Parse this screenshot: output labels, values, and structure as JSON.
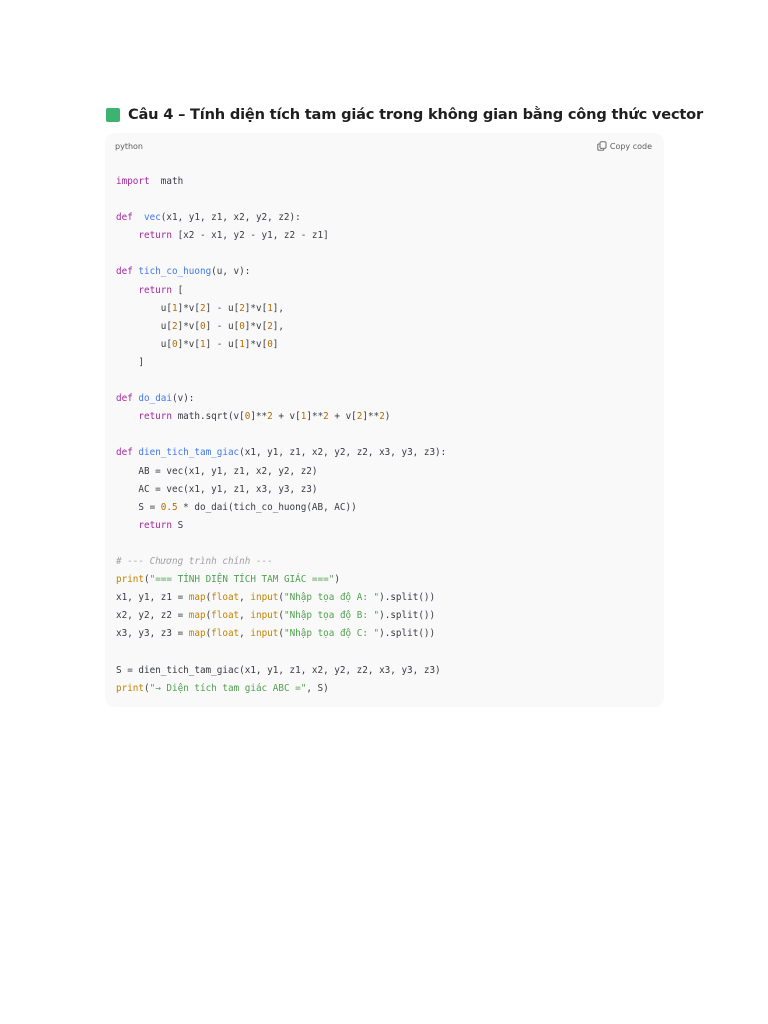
{
  "heading": {
    "icon": "green-square-icon",
    "icon_color": "#3cb371",
    "text": "Câu 4 – Tính diện tích tam giác trong không gian bằng công thức vector"
  },
  "code_block": {
    "language": "python",
    "copy_label": "Copy code",
    "copy_icon": "copy-icon",
    "lines": [
      [
        [
          "kw",
          "import"
        ],
        [
          "",
          "  math"
        ]
      ],
      [],
      [
        [
          "kw",
          "def"
        ],
        [
          "",
          "  "
        ],
        [
          "fn",
          "vec"
        ],
        [
          "",
          "(x1, y1, z1, x2, y2, z2):"
        ]
      ],
      [
        [
          "",
          "    "
        ],
        [
          "kw",
          "return"
        ],
        [
          "",
          " [x2 - x1, y2 - y1, z2 - z1]"
        ]
      ],
      [],
      [
        [
          "kw",
          "def"
        ],
        [
          "",
          " "
        ],
        [
          "fn",
          "tich_co_huong"
        ],
        [
          "",
          "(u, v):"
        ]
      ],
      [
        [
          "",
          "    "
        ],
        [
          "kw",
          "return"
        ],
        [
          "",
          " ["
        ]
      ],
      [
        [
          "",
          "        u["
        ],
        [
          "num",
          "1"
        ],
        [
          "",
          "]*v["
        ],
        [
          "num",
          "2"
        ],
        [
          "",
          "] - u["
        ],
        [
          "num",
          "2"
        ],
        [
          "",
          "]*v["
        ],
        [
          "num",
          "1"
        ],
        [
          "",
          "],"
        ]
      ],
      [
        [
          "",
          "        u["
        ],
        [
          "num",
          "2"
        ],
        [
          "",
          "]*v["
        ],
        [
          "num",
          "0"
        ],
        [
          "",
          "] - u["
        ],
        [
          "num",
          "0"
        ],
        [
          "",
          "]*v["
        ],
        [
          "num",
          "2"
        ],
        [
          "",
          "],"
        ]
      ],
      [
        [
          "",
          "        u["
        ],
        [
          "num",
          "0"
        ],
        [
          "",
          "]*v["
        ],
        [
          "num",
          "1"
        ],
        [
          "",
          "] - u["
        ],
        [
          "num",
          "1"
        ],
        [
          "",
          "]*v["
        ],
        [
          "num",
          "0"
        ],
        [
          "",
          "]"
        ]
      ],
      [
        [
          "",
          "    ]"
        ]
      ],
      [],
      [
        [
          "kw",
          "def"
        ],
        [
          "",
          " "
        ],
        [
          "fn",
          "do_dai"
        ],
        [
          "",
          "(v):"
        ]
      ],
      [
        [
          "",
          "    "
        ],
        [
          "kw",
          "return"
        ],
        [
          "",
          " math.sqrt(v["
        ],
        [
          "num",
          "0"
        ],
        [
          "",
          "]**"
        ],
        [
          "num",
          "2"
        ],
        [
          "",
          " + v["
        ],
        [
          "num",
          "1"
        ],
        [
          "",
          "]**"
        ],
        [
          "num",
          "2"
        ],
        [
          "",
          " + v["
        ],
        [
          "num",
          "2"
        ],
        [
          "",
          "]**"
        ],
        [
          "num",
          "2"
        ],
        [
          "",
          ")"
        ]
      ],
      [],
      [
        [
          "kw",
          "def"
        ],
        [
          "",
          " "
        ],
        [
          "fn",
          "dien_tich_tam_giac"
        ],
        [
          "",
          "(x1, y1, z1, x2, y2, z2, x3, y3, z3):"
        ]
      ],
      [
        [
          "",
          "    AB = vec(x1, y1, z1, x2, y2, z2)"
        ]
      ],
      [
        [
          "",
          "    AC = vec(x1, y1, z1, x3, y3, z3)"
        ]
      ],
      [
        [
          "",
          "    S = "
        ],
        [
          "num",
          "0.5"
        ],
        [
          "",
          " * do_dai(tich_co_huong(AB, AC))"
        ]
      ],
      [
        [
          "",
          "    "
        ],
        [
          "kw",
          "return"
        ],
        [
          "",
          " S"
        ]
      ],
      [],
      [
        [
          "cm",
          "# --- Chương trình chính ---"
        ]
      ],
      [
        [
          "bi",
          "print"
        ],
        [
          "",
          "("
        ],
        [
          "str",
          "\"=== TÍNH DIỆN TÍCH TAM GIÁC ===\""
        ],
        [
          "",
          ")"
        ]
      ],
      [
        [
          "",
          "x1, y1, z1 = "
        ],
        [
          "bi",
          "map"
        ],
        [
          "",
          "("
        ],
        [
          "bi",
          "float"
        ],
        [
          "",
          ", "
        ],
        [
          "bi",
          "input"
        ],
        [
          "",
          "("
        ],
        [
          "str",
          "\"Nhập tọa độ A: \""
        ],
        [
          "",
          ").split())"
        ]
      ],
      [
        [
          "",
          "x2, y2, z2 = "
        ],
        [
          "bi",
          "map"
        ],
        [
          "",
          "("
        ],
        [
          "bi",
          "float"
        ],
        [
          "",
          ", "
        ],
        [
          "bi",
          "input"
        ],
        [
          "",
          "("
        ],
        [
          "str",
          "\"Nhập tọa độ B: \""
        ],
        [
          "",
          ").split())"
        ]
      ],
      [
        [
          "",
          "x3, y3, z3 = "
        ],
        [
          "bi",
          "map"
        ],
        [
          "",
          "("
        ],
        [
          "bi",
          "float"
        ],
        [
          "",
          ", "
        ],
        [
          "bi",
          "input"
        ],
        [
          "",
          "("
        ],
        [
          "str",
          "\"Nhập tọa độ C: \""
        ],
        [
          "",
          ").split())"
        ]
      ],
      [],
      [
        [
          "",
          "S = dien_tich_tam_giac(x1, y1, z1, x2, y2, z2, x3, y3, z3)"
        ]
      ],
      [
        [
          "bi",
          "print"
        ],
        [
          "",
          "("
        ],
        [
          "str",
          "\"→ Diện tích tam giác ABC =\""
        ],
        [
          "",
          ", S)"
        ]
      ]
    ]
  }
}
